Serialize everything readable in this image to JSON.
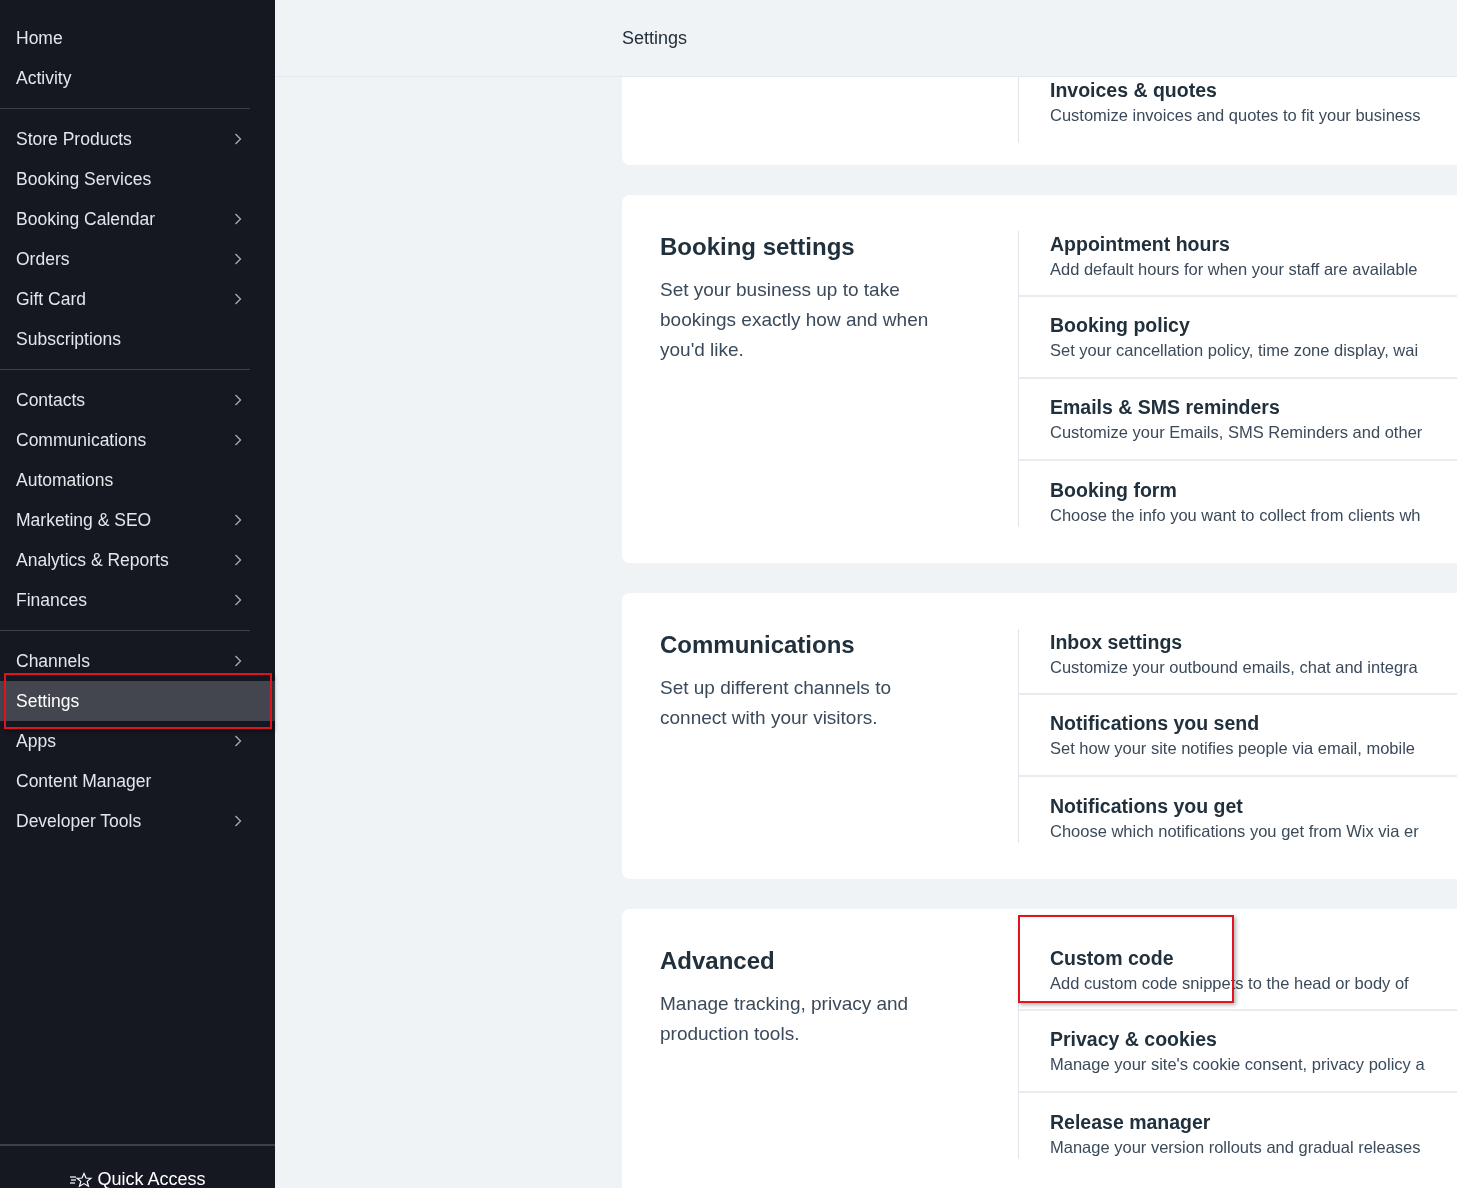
{
  "sidebar": {
    "groups": [
      [
        {
          "label": "Home",
          "has_arrow": false,
          "selected": false,
          "highlighted": false
        },
        {
          "label": "Activity",
          "has_arrow": false,
          "selected": false,
          "highlighted": false
        }
      ],
      [
        {
          "label": "Store Products",
          "has_arrow": true,
          "selected": false,
          "highlighted": false
        },
        {
          "label": "Booking Services",
          "has_arrow": false,
          "selected": false,
          "highlighted": false
        },
        {
          "label": "Booking Calendar",
          "has_arrow": true,
          "selected": false,
          "highlighted": false
        },
        {
          "label": "Orders",
          "has_arrow": true,
          "selected": false,
          "highlighted": false
        },
        {
          "label": "Gift Card",
          "has_arrow": true,
          "selected": false,
          "highlighted": false
        },
        {
          "label": "Subscriptions",
          "has_arrow": false,
          "selected": false,
          "highlighted": false
        }
      ],
      [
        {
          "label": "Contacts",
          "has_arrow": true,
          "selected": false,
          "highlighted": false
        },
        {
          "label": "Communications",
          "has_arrow": true,
          "selected": false,
          "highlighted": false
        },
        {
          "label": "Automations",
          "has_arrow": false,
          "selected": false,
          "highlighted": false
        },
        {
          "label": "Marketing & SEO",
          "has_arrow": true,
          "selected": false,
          "highlighted": false
        },
        {
          "label": "Analytics & Reports",
          "has_arrow": true,
          "selected": false,
          "highlighted": false
        },
        {
          "label": "Finances",
          "has_arrow": true,
          "selected": false,
          "highlighted": false
        }
      ],
      [
        {
          "label": "Channels",
          "has_arrow": true,
          "selected": false,
          "highlighted": false
        },
        {
          "label": "Settings",
          "has_arrow": false,
          "selected": true,
          "highlighted": true
        },
        {
          "label": "Apps",
          "has_arrow": true,
          "selected": false,
          "highlighted": false
        },
        {
          "label": "Content Manager",
          "has_arrow": false,
          "selected": false,
          "highlighted": false
        },
        {
          "label": "Developer Tools",
          "has_arrow": true,
          "selected": false,
          "highlighted": false
        }
      ]
    ],
    "footer": "Quick Access"
  },
  "header": {
    "title": "Settings"
  },
  "cards": [
    {
      "items": [
        {
          "title": "Invoices & quotes",
          "description": "Customize invoices and quotes to fit your business",
          "highlighted": false
        }
      ]
    },
    {
      "title": "Booking settings",
      "description": "Set your business up to take bookings exactly how and when you'd like.",
      "items": [
        {
          "title": "Appointment hours",
          "description": "Add default hours for when your staff are available",
          "highlighted": false
        },
        {
          "title": "Booking policy",
          "description": "Set your cancellation policy, time zone display, wai",
          "highlighted": false
        },
        {
          "title": "Emails & SMS reminders",
          "description": "Customize your Emails, SMS Reminders and other",
          "highlighted": false
        },
        {
          "title": "Booking form",
          "description": "Choose the info you want to collect from clients wh",
          "highlighted": false
        }
      ]
    },
    {
      "title": "Communications",
      "description": "Set up different channels to connect with your visitors.",
      "items": [
        {
          "title": "Inbox settings",
          "description": "Customize your outbound emails, chat and integra",
          "highlighted": false
        },
        {
          "title": "Notifications you send",
          "description": "Set how your site notifies people via email, mobile",
          "highlighted": false
        },
        {
          "title": "Notifications you get",
          "description": "Choose which notifications you get from Wix via er",
          "highlighted": false
        }
      ]
    },
    {
      "title": "Advanced",
      "description": "Manage tracking, privacy and production tools.",
      "items": [
        {
          "title": "Custom code",
          "description": "Add custom code snippets to the head or body of",
          "highlighted": true
        },
        {
          "title": "Privacy & cookies",
          "description": "Manage your site's cookie consent, privacy policy a",
          "highlighted": false
        },
        {
          "title": "Release manager",
          "description": "Manage your version rollouts and gradual releases",
          "highlighted": false
        }
      ]
    }
  ]
}
